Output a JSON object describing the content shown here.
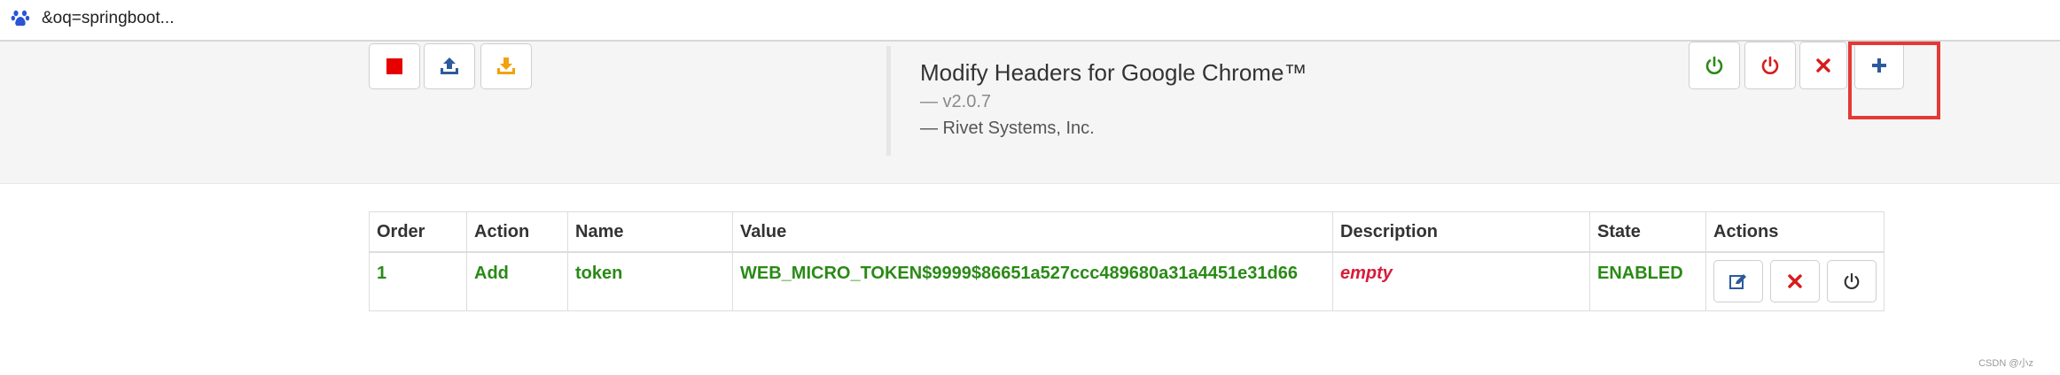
{
  "topbar": {
    "text": "&oq=springboot...",
    "icon": "baidu-paw-icon"
  },
  "toolbar_left": [
    {
      "name": "stop-icon",
      "color": "#e60000"
    },
    {
      "name": "upload-icon",
      "color": "#2d5a9c"
    },
    {
      "name": "download-icon",
      "color": "#f0a30a"
    }
  ],
  "header": {
    "title": "Modify Headers for Google Chrome™",
    "version": "— v2.0.7",
    "company": "— Rivet Systems, Inc."
  },
  "toolbar_right": [
    {
      "name": "power-on-icon",
      "color": "#2a8a16"
    },
    {
      "name": "power-off-icon",
      "color": "#d81b1b"
    },
    {
      "name": "close-icon",
      "color": "#d81b1b"
    },
    {
      "name": "plus-icon",
      "color": "#2d5a9c"
    }
  ],
  "table": {
    "columns": [
      "Order",
      "Action",
      "Name",
      "Value",
      "Description",
      "State",
      "Actions"
    ],
    "rows": [
      {
        "order": "1",
        "action": "Add",
        "name": "token",
        "value": "WEB_MICRO_TOKEN$9999$86651a527ccc489680a31a4451e31d66",
        "description": "empty",
        "state": "ENABLED"
      }
    ]
  },
  "watermark": "CSDN @小z",
  "colors": {
    "accent_green": "#2a8a16",
    "accent_red": "#d81b3a",
    "accent_blue": "#2d5a9c",
    "highlight": "#e53935"
  }
}
